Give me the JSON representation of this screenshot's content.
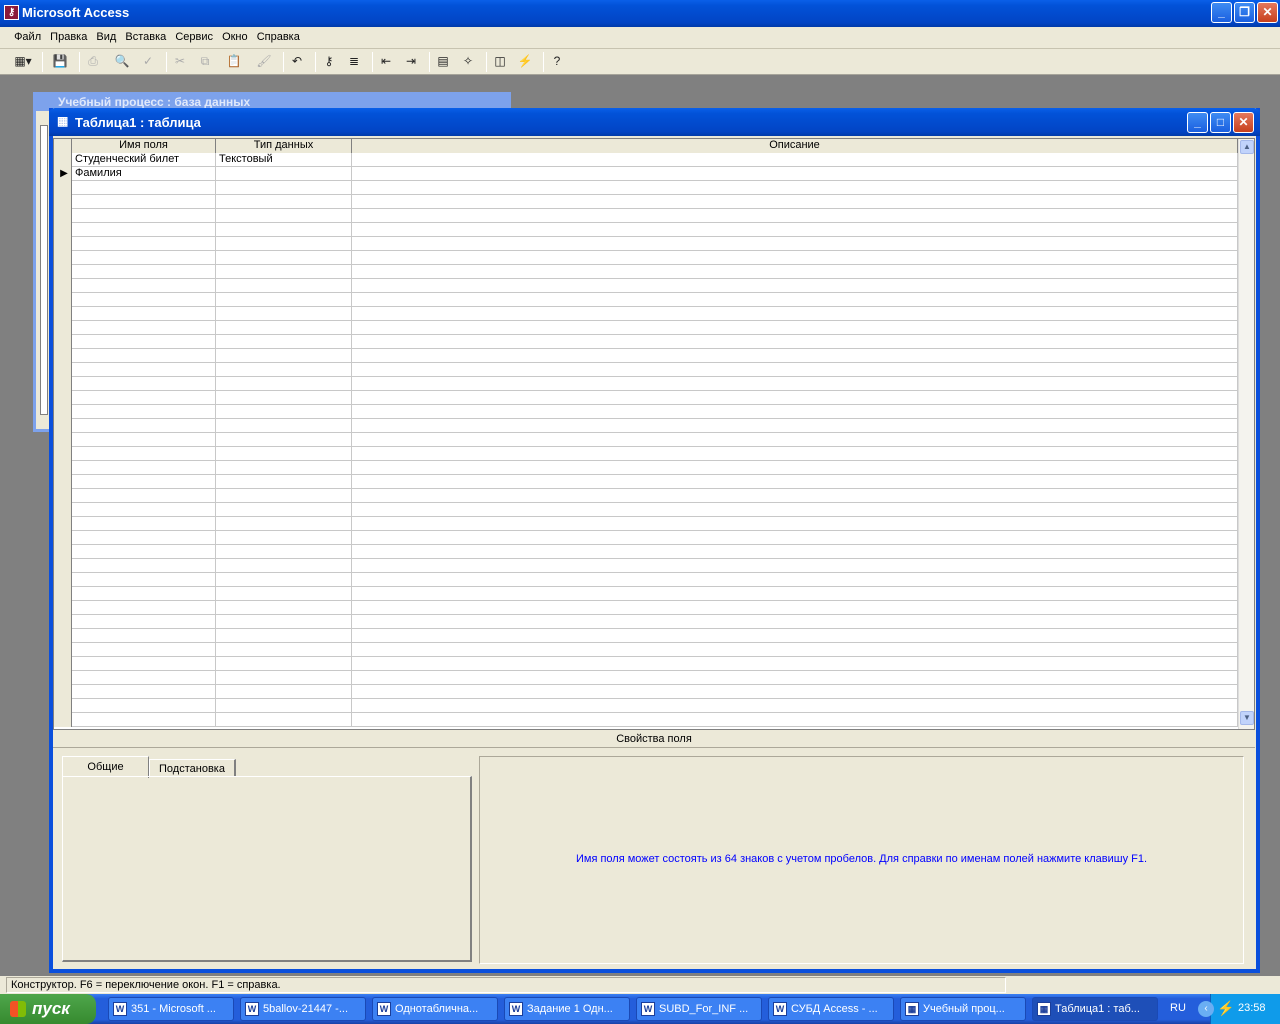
{
  "app": {
    "title": "Microsoft Access"
  },
  "menu": [
    {
      "label": "Файл"
    },
    {
      "label": "Правка"
    },
    {
      "label": "Вид"
    },
    {
      "label": "Вставка"
    },
    {
      "label": "Сервис"
    },
    {
      "label": "Окно"
    },
    {
      "label": "Справка"
    }
  ],
  "toolbar": [
    {
      "icon": "view-icon",
      "glyph": "▦▾",
      "enabled": true
    },
    {
      "icon": "save-icon",
      "glyph": "💾",
      "enabled": true
    },
    {
      "icon": "print-icon",
      "glyph": "⎙",
      "enabled": false
    },
    {
      "icon": "print-preview-icon",
      "glyph": "🔍",
      "enabled": false
    },
    {
      "icon": "spelling-icon",
      "glyph": "✓",
      "enabled": false
    },
    {
      "icon": "cut-icon",
      "glyph": "✂",
      "enabled": false
    },
    {
      "icon": "copy-icon",
      "glyph": "⧉",
      "enabled": false
    },
    {
      "icon": "paste-icon",
      "glyph": "📋",
      "enabled": true
    },
    {
      "icon": "format-painter-icon",
      "glyph": "🖌",
      "enabled": false
    },
    {
      "icon": "undo-icon",
      "glyph": "↶",
      "enabled": true
    },
    {
      "icon": "primary-key-icon",
      "glyph": "⚷",
      "enabled": true
    },
    {
      "icon": "indexes-icon",
      "glyph": "≣",
      "enabled": true
    },
    {
      "icon": "insert-rows-icon",
      "glyph": "⇤",
      "enabled": true
    },
    {
      "icon": "delete-rows-icon",
      "glyph": "⇥",
      "enabled": true
    },
    {
      "icon": "properties-icon",
      "glyph": "▤",
      "enabled": true
    },
    {
      "icon": "build-icon",
      "glyph": "✧",
      "enabled": true
    },
    {
      "icon": "database-window-icon",
      "glyph": "◫",
      "enabled": true
    },
    {
      "icon": "new-object-icon",
      "glyph": "⚡",
      "enabled": true
    },
    {
      "icon": "help-icon",
      "glyph": "?",
      "enabled": true
    }
  ],
  "background_window": {
    "title": "Учебный процесс : база данных"
  },
  "table_window": {
    "title": "Таблица1 : таблица"
  },
  "grid": {
    "columns": [
      "Имя поля",
      "Тип данных",
      "Описание"
    ],
    "rows": [
      {
        "name": "Студенческий билет",
        "type": "Текстовый",
        "description": ""
      },
      {
        "name": "Фамилия",
        "type": "",
        "description": "",
        "current": true
      }
    ]
  },
  "properties": {
    "section_label": "Свойства поля",
    "tabs": [
      {
        "label": "Общие",
        "active": true
      },
      {
        "label": "Подстановка",
        "active": false
      }
    ],
    "hint": "Имя поля может состоять из 64 знаков с учетом пробелов.  Для справки по именам полей нажмите клавишу F1.",
    "hint_color": "#0000ff"
  },
  "status_bar": {
    "text": "Конструктор.  F6 = переключение окон.  F1 = справка."
  },
  "taskbar": {
    "start": "пуск",
    "items": [
      {
        "label": "351 - Microsoft ...",
        "icon": "word-icon"
      },
      {
        "label": "5ballov-21447 -...",
        "icon": "word-icon"
      },
      {
        "label": "Однотаблична...",
        "icon": "word-icon"
      },
      {
        "label": "Задание 1 Одн...",
        "icon": "word-icon"
      },
      {
        "label": "SUBD_For_INF ...",
        "icon": "word-icon"
      },
      {
        "label": "СУБД Access - ...",
        "icon": "word-icon"
      },
      {
        "label": "Учебный проц...",
        "icon": "access-db-icon"
      },
      {
        "label": "Таблица1 : таб...",
        "icon": "table-icon",
        "active": true
      }
    ],
    "lang": "RU",
    "clock": "23:58"
  }
}
